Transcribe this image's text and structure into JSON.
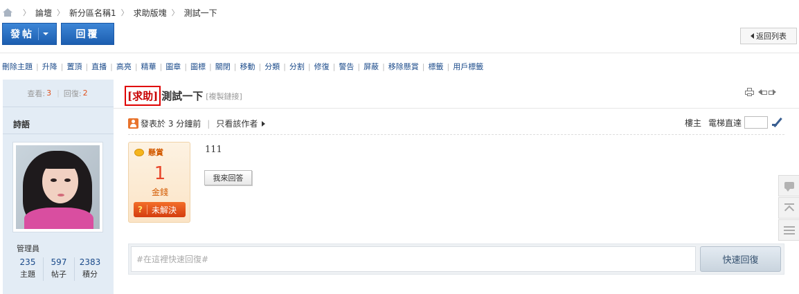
{
  "breadcrumb": {
    "items": [
      "論壇",
      "新分區名稱1",
      "求助版塊",
      "測試一下"
    ]
  },
  "toolbar": {
    "post_label": "發帖",
    "reply_label": "回覆",
    "back_label": "返回列表"
  },
  "mod_actions": [
    "刪除主題",
    "升降",
    "置頂",
    "直播",
    "高亮",
    "精華",
    "圖章",
    "圖標",
    "關閉",
    "移動",
    "分類",
    "分割",
    "修復",
    "警告",
    "屏蔽",
    "移除懸賞",
    "標籤",
    "用戶標籤"
  ],
  "thread_stats": {
    "views_label": "查看:",
    "views": "3",
    "replies_label": "回復:",
    "replies": "2"
  },
  "author": {
    "name": "詩語",
    "group": "管理員",
    "stats": [
      {
        "value": "235",
        "label": "主題"
      },
      {
        "value": "597",
        "label": "帖子"
      },
      {
        "value": "2383",
        "label": "積分"
      }
    ]
  },
  "post": {
    "type_tag": "[求助]",
    "title": "測試一下",
    "copy_link": "[複製鏈接]",
    "posted_at": "發表於 3 分鐘前",
    "only_author": "只看該作者",
    "floor_label": "樓主",
    "jump_label": "電梯直達",
    "body": "111",
    "reply_button": "我來回答"
  },
  "reward": {
    "label": "懸賞",
    "amount": "1",
    "unit": "金錢",
    "status_icon": "?",
    "status": "未解決"
  },
  "quick_reply": {
    "placeholder": "#在這裡快速回復#",
    "send_label": "快速回復"
  },
  "colors": {
    "accent_blue": "#1c5eb0",
    "tag_red": "#c80000",
    "reward_orange": "#e8452a"
  }
}
